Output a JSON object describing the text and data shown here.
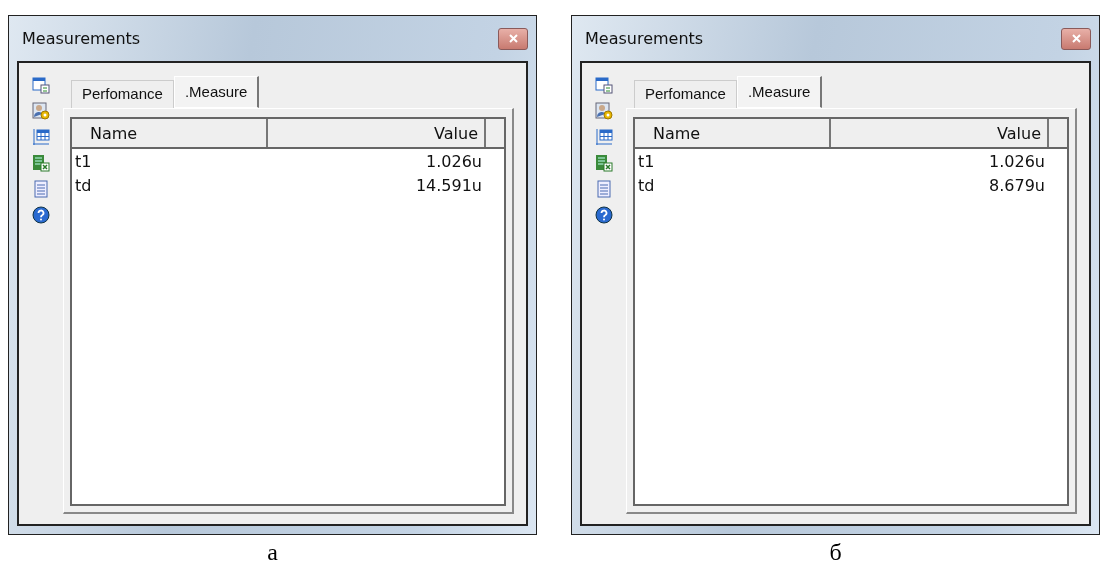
{
  "panels": [
    {
      "window": {
        "title": "Measurements"
      },
      "tabs": [
        {
          "label": "Perfomance",
          "selected": false
        },
        {
          "label": ".Measure",
          "selected": true
        }
      ],
      "columns": [
        "Name",
        "Value"
      ],
      "rows": [
        {
          "name": "t1",
          "value": "1.026u"
        },
        {
          "name": "td",
          "value": "14.591u"
        }
      ],
      "caption": "а"
    },
    {
      "window": {
        "title": "Measurements"
      },
      "tabs": [
        {
          "label": "Perfomance",
          "selected": false
        },
        {
          "label": ".Measure",
          "selected": true
        }
      ],
      "columns": [
        "Name",
        "Value"
      ],
      "rows": [
        {
          "name": "t1",
          "value": "1.026u"
        },
        {
          "name": "td",
          "value": "8.679u"
        }
      ],
      "caption": "б"
    }
  ]
}
